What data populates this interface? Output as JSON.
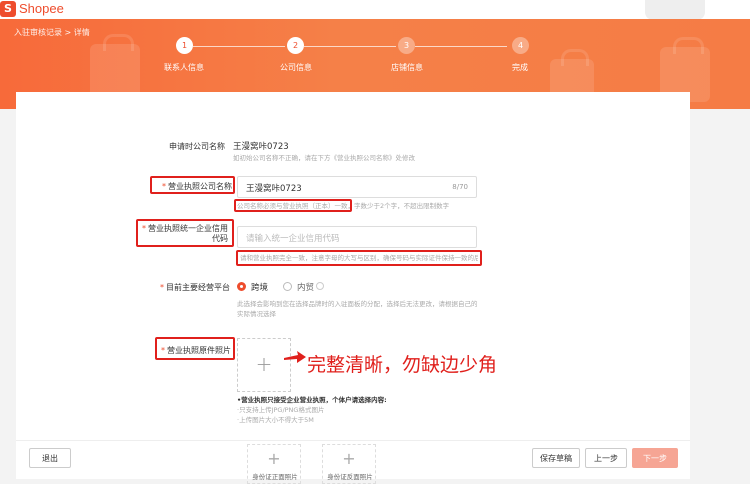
{
  "brand": {
    "logo_letter": "S",
    "name": "Shopee"
  },
  "breadcrumb": {
    "parent": "入驻审核记录",
    "sep": ">",
    "current": "详情"
  },
  "steps": [
    {
      "num": "1",
      "label": "联系人信息"
    },
    {
      "num": "2",
      "label": "公司信息"
    },
    {
      "num": "3",
      "label": "店铺信息"
    },
    {
      "num": "4",
      "label": "完成"
    }
  ],
  "form": {
    "apply_company": {
      "label": "申请时公司名称",
      "value": "王漫窝咔0723",
      "hint": "如初始公司名称不正确，请在下方《营业执照公司名称》处修改"
    },
    "license_company": {
      "required": "*",
      "label": "营业执照公司名称",
      "value": "王漫窝咔0723",
      "counter": "8/70",
      "hint": "公司名称必须与营业执照（正本）一致，字数少于2个字，不超出限制数字"
    },
    "credit_code": {
      "required": "*",
      "label": "营业执照统一企业信用代码",
      "placeholder": "请输入统一企业信用代码",
      "hint": "请和营业执照完全一致，注意字母的大写与区别，确保号码与实际证件保持一致的后五位"
    },
    "platform": {
      "required": "*",
      "label": "目前主要经营平台",
      "opt1": "跨境",
      "opt2": "内贸",
      "hint": "此选择会影响到您在选择品牌时的入驻面板的分配，选择后无法更改，请根据自己的实际情况选择"
    },
    "license_photo": {
      "required": "*",
      "label": "营业执照原件照片",
      "plus": "+",
      "req_title": "•营业执照只接受企业营业执照，个体户请选择内容:",
      "req1": "·只支持上传JPG/PNG格式图片",
      "req2": "·上传图片大小不得大于5M"
    }
  },
  "annotation": "完整清晰，勿缺边少角",
  "footer": {
    "exit": "退出",
    "upload1": "身份证正面照片",
    "upload2": "身份证反面照片",
    "save_draft": "保存草稿",
    "prev": "上一步",
    "next": "下一步"
  }
}
